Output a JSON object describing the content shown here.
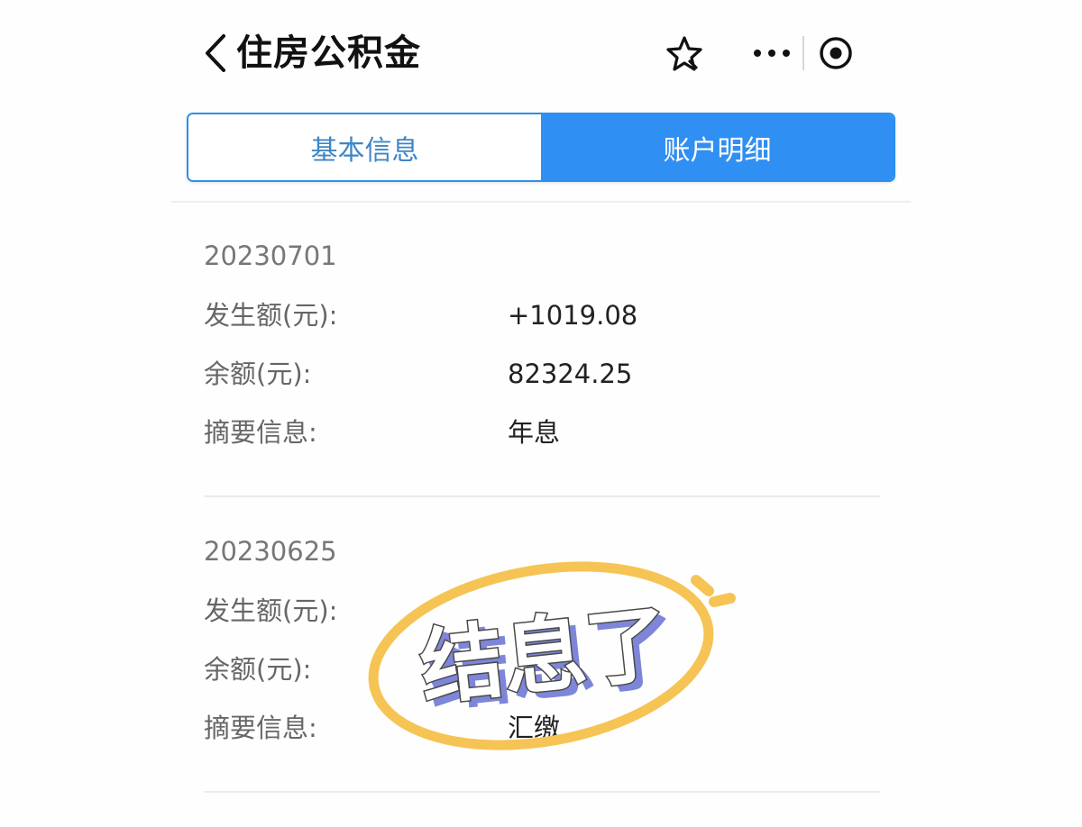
{
  "header": {
    "title": "住房公积金",
    "back_icon": "chevron-left-icon",
    "favorite_icon": "star-icon",
    "more_icon": "more-dots-icon",
    "close_icon": "target-close-icon"
  },
  "tabs": [
    {
      "label": "基本信息",
      "active": false
    },
    {
      "label": "账户明细",
      "active": true
    }
  ],
  "records": [
    {
      "date": "20230701",
      "rows": [
        {
          "label": "发生额(元):",
          "value": "+1019.08"
        },
        {
          "label": "余额(元):",
          "value": "82324.25"
        },
        {
          "label": "摘要信息:",
          "value": "年息"
        }
      ]
    },
    {
      "date": "20230625",
      "rows": [
        {
          "label": "发生额(元):",
          "value": ""
        },
        {
          "label": "余额(元):",
          "value": ""
        },
        {
          "label": "摘要信息:",
          "value": "汇缴"
        }
      ]
    }
  ],
  "sticker": {
    "text": "结息了"
  },
  "colors": {
    "accent": "#2f8ff2",
    "tab_inactive_text": "#3d86c6",
    "sticker_ring": "#f6c454",
    "sticker_shadow": "#7d86d8"
  }
}
